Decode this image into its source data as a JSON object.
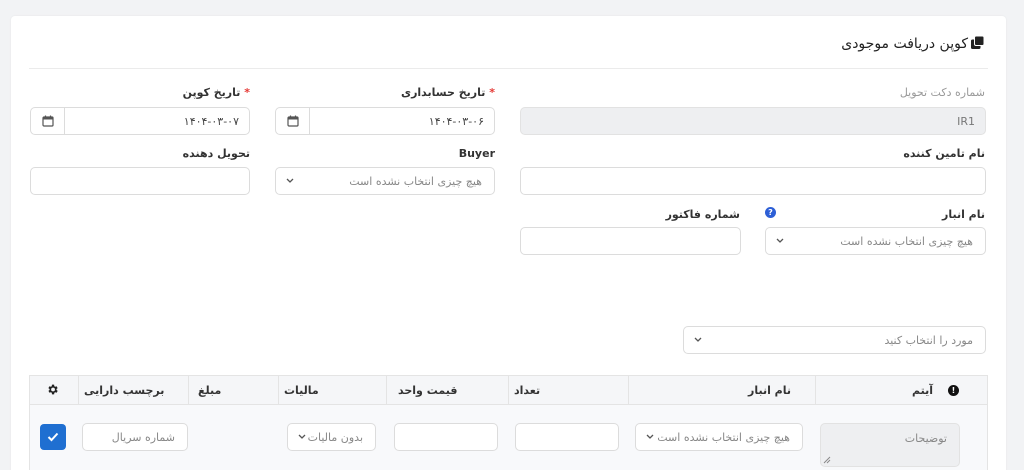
{
  "page": {
    "title": "کوپن دریافت موجودی"
  },
  "form": {
    "docket_number": {
      "label": "شماره دکت تحویل",
      "value": "IR1"
    },
    "accounting_date": {
      "label": "تاریخ حسابداری",
      "required_mark": "*",
      "value": "۱۴۰۴-۰۳-۰۶"
    },
    "coupon_date": {
      "label": "تاریخ کوپن",
      "required_mark": "*",
      "value": "۱۴۰۴-۰۳-۰۷"
    },
    "supplier_name": {
      "label": "نام تامین کننده",
      "value": ""
    },
    "buyer": {
      "label": "Buyer",
      "placeholder": "هیچ چیزی انتخاب نشده است"
    },
    "deliverer": {
      "label": "تحویل دهنده",
      "value": ""
    },
    "warehouse": {
      "label": "نام انبار",
      "help_glyph": "?",
      "placeholder": "هیچ چیزی انتخاب نشده است"
    },
    "invoice_number": {
      "label": "شماره فاکتور",
      "value": ""
    },
    "item_selector": {
      "placeholder": "مورد را انتخاب کنید"
    }
  },
  "table": {
    "columns": {
      "item": "آیتم",
      "item_alert_glyph": "!",
      "warehouse": "نام انبار",
      "quantity": "تعداد",
      "unit_price": "قیمت واحد",
      "tax": "مالیات",
      "amount": "مبلغ",
      "asset_tag": "برچسب دارایی"
    },
    "row": {
      "description_placeholder": "توضیحات",
      "warehouse_placeholder": "هیچ چیزی انتخاب نشده است",
      "tax_placeholder": "بدون مالیات",
      "serial_placeholder": "شماره سریال"
    }
  },
  "colors": {
    "accent": "#1f6fd1",
    "required": "#e53935",
    "help": "#2d5fd6"
  }
}
